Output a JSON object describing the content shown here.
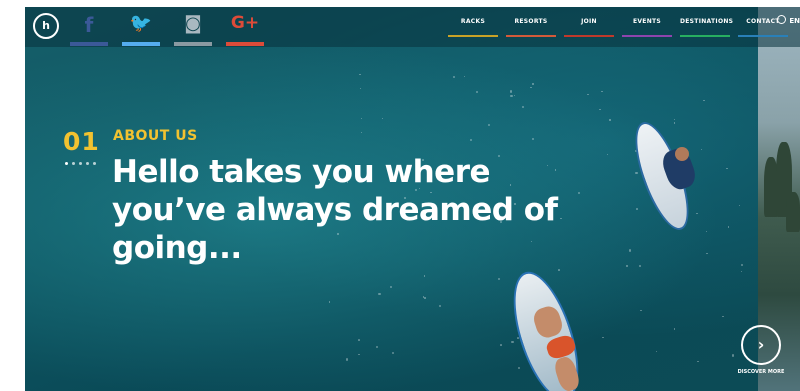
{
  "logo": {
    "text": "h",
    "icon": "hello-smile-logo"
  },
  "social": [
    {
      "name": "facebook-icon",
      "glyph": "f",
      "bar": "#3b5998"
    },
    {
      "name": "twitter-icon",
      "glyph": "🐦",
      "bar": "#55acee"
    },
    {
      "name": "instagram-icon",
      "glyph": "◙",
      "bar": "#8a9aa2"
    },
    {
      "name": "googleplus-icon",
      "glyph": "G+",
      "bar": "#dd4b39"
    }
  ],
  "nav": [
    {
      "label": "RACKS",
      "color": "#c9a227"
    },
    {
      "label": "RESORTS",
      "color": "#d45a3a"
    },
    {
      "label": "JOIN",
      "color": "#c0392b"
    },
    {
      "label": "EVENTS",
      "color": "#8e44ad"
    },
    {
      "label": "DESTINATIONS",
      "color": "#27ae60"
    },
    {
      "label": "CONTACT",
      "color": "#2980b9"
    }
  ],
  "language": "EN",
  "section": {
    "number": "01",
    "label": "ABOUT US",
    "headline": "Hello takes you where you’ve always dreamed of going..."
  },
  "discover": {
    "label": "DISCOVER MORE",
    "arrow": "›"
  },
  "colors": {
    "accent": "#f2c230",
    "ocean": "#0e5561"
  }
}
